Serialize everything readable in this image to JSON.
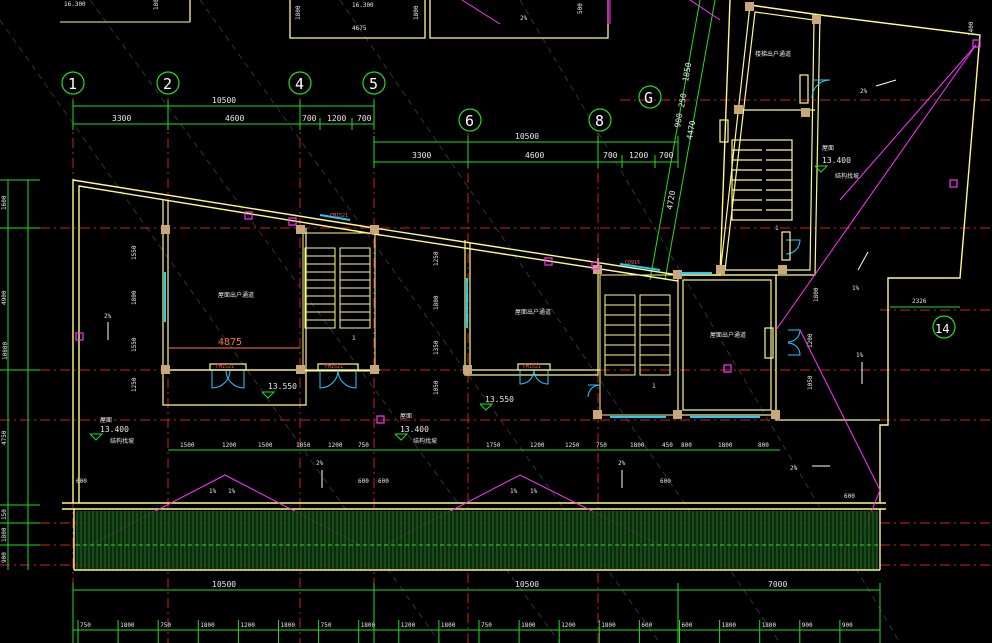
{
  "axes": [
    "1",
    "2",
    "4",
    "5",
    "6",
    "8",
    "G",
    "14"
  ],
  "top_dims_left": {
    "overall": "10500",
    "parts": [
      "3300",
      "4600",
      "700",
      "1200",
      "700"
    ]
  },
  "top_dims_right": {
    "overall": "10500",
    "parts": [
      "3300",
      "4600",
      "700",
      "1200",
      "700"
    ]
  },
  "top_fragments": {
    "left_level": "16.300",
    "left_dim": "1800",
    "mid_level": "16.300",
    "mid_dim": "4675",
    "mid_v1": "1800",
    "mid_v2": "1800",
    "mid_slope": "2%",
    "mid_v3": "500"
  },
  "left_vertical_dims": [
    "1600",
    "4900",
    "10800",
    "4750",
    "150",
    "1800",
    "900"
  ],
  "room_dims": {
    "room1_v": [
      "1550",
      "1800",
      "1550",
      "1250"
    ],
    "room2_v": [
      "1250",
      "1800",
      "1350",
      "1050"
    ],
    "room1_width": "4875",
    "right_dims": [
      "4470",
      "4720",
      "1850",
      "250",
      "900"
    ],
    "right_vertical": [
      "1800",
      "1200",
      "1050"
    ],
    "right_h": "2326",
    "topright": "1400"
  },
  "levels": {
    "left_room": "13.550",
    "right_room": "13.550",
    "roof_left": "13.400",
    "roof_mid": "13.400",
    "right_tower": "13.400"
  },
  "labels": {
    "room1": "屋面出户通道",
    "room2": "屋面出户通道",
    "room3": "屋面出户通道",
    "room4": "屋面",
    "roof_left": "屋面",
    "roof_mid": "屋面",
    "note_left": "结构找坡",
    "note_mid": "结构找坡",
    "note_right": "结构找坡",
    "door1": "FM1521",
    "door2": "FM1521",
    "door3": "FM1521",
    "door4": "FM1521",
    "window": "C0915",
    "tower_room": "楼梯出户通道",
    "tower_name": "屋面",
    "stair_mark": "1"
  },
  "slopes": [
    "2%",
    "2%",
    "1%",
    "1%",
    "1%",
    "1%",
    "2%",
    "1%",
    "2%",
    "2%",
    "1%"
  ],
  "gap_dims": {
    "row": [
      "1500",
      "1200",
      "1500",
      "1050",
      "1200",
      "750",
      "1750",
      "1200",
      "1250",
      "750",
      "1800",
      "450",
      "800",
      "1800",
      "800"
    ],
    "gutters": [
      "600",
      "600",
      "600",
      "600",
      "600"
    ]
  },
  "bottom_dims": {
    "overall": [
      "10500",
      "10500",
      "7000"
    ],
    "row": [
      "750",
      "1800",
      "750",
      "1800",
      "1200",
      "1800",
      "750",
      "1800",
      "1200",
      "1800",
      "750",
      "1800",
      "1200",
      "1800",
      "600",
      "600",
      "1800",
      "1800",
      "900",
      "900"
    ]
  },
  "colors": {
    "background": "#000000",
    "wall": "#fffa84",
    "axis_line": "#cc2222",
    "axis_circle": "#22dd22",
    "dimension": "#22dd22",
    "text": "#ffffff",
    "magenta": "#ff33ff",
    "cyan": "#22ccff",
    "column": "#c8a87a"
  }
}
